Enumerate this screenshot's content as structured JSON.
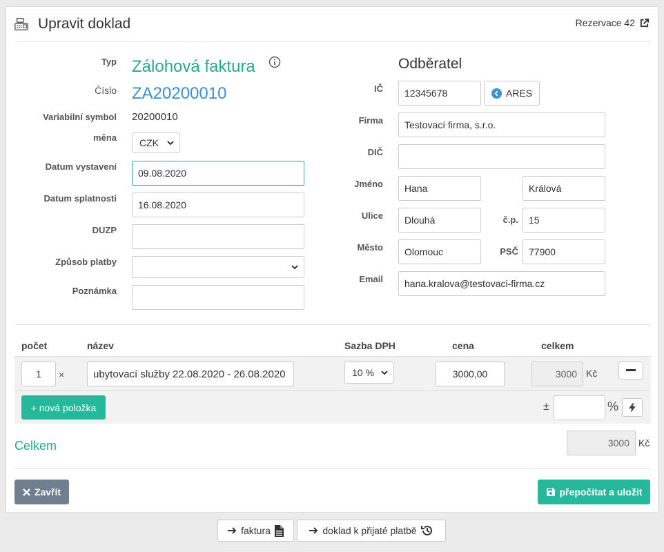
{
  "header": {
    "title": "Upravit doklad",
    "reservation_link": "Rezervace 42"
  },
  "doc": {
    "typ_label": "Typ",
    "typ_value": "Zálohová faktura",
    "cislo_label": "Číslo",
    "cislo_value": "ZA20200010",
    "vs_label": "Variabilní symbol",
    "vs_value": "20200010",
    "mena_label": "měna",
    "mena_value": "CZK",
    "datum_vystaveni_label": "Datum vystavení",
    "datum_vystaveni_value": "09.08.2020",
    "datum_splatnosti_label": "Datum splatnosti",
    "datum_splatnosti_value": "16.08.2020",
    "duzp_label": "DUZP",
    "duzp_value": "",
    "zpusob_platby_label": "Způsob platby",
    "zpusob_platby_value": "",
    "poznamka_label": "Poznámka",
    "poznamka_value": ""
  },
  "customer": {
    "heading": "Odběratel",
    "ic_label": "IČ",
    "ic_value": "12345678",
    "ares_button": "ARES",
    "firma_label": "Firma",
    "firma_value": "Testovací firma, s.r.o.",
    "dic_label": "DIČ",
    "dic_value": "",
    "jmeno_label": "Jméno",
    "jmeno_value": "Hana",
    "prijmeni_value": "Králová",
    "ulice_label": "Ulice",
    "ulice_value": "Dlouhá",
    "cp_label": "č.p.",
    "cp_value": "15",
    "mesto_label": "Město",
    "mesto_value": "Olomouc",
    "psc_label": "PSČ",
    "psc_value": "77900",
    "email_label": "Email",
    "email_value": "hana.kralova@testovaci-firma.cz"
  },
  "items": {
    "headers": {
      "pocet": "počet",
      "nazev": "název",
      "sazba": "Sazba DPH",
      "cena": "cena",
      "celkem": "celkem"
    },
    "rows": [
      {
        "pocet": "1",
        "times": "×",
        "nazev": "ubytovací služby 22.08.2020 - 26.08.2020",
        "sazba": "10 %",
        "cena": "3000,00",
        "celkem": "3000",
        "currency": "Kč"
      }
    ],
    "new_item_button": "+ nová položka",
    "plusminus": "±",
    "discount_value": "",
    "percent": "%"
  },
  "total": {
    "label": "Celkem",
    "value": "3000",
    "currency": "Kč"
  },
  "actions": {
    "close_button": "Zavřít",
    "save_button": "přepočítat a uložit"
  },
  "bottom": {
    "faktura_button": "faktura",
    "doklad_button": "doklad k přijaté platbě"
  }
}
